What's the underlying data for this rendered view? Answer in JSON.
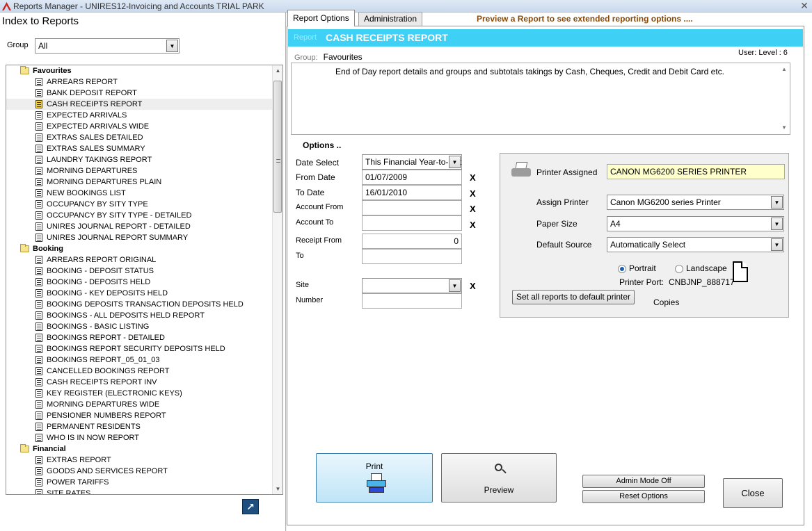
{
  "window": {
    "title": "Reports Manager - UNIRES12-Invoicing and Accounts TRIAL PARK",
    "close_glyph": "✕"
  },
  "left": {
    "heading": "Index to Reports",
    "group_label": "Group",
    "group_value": "All",
    "groups": [
      {
        "name": "Favourites",
        "items": [
          "ARREARS REPORT",
          "BANK DEPOSIT REPORT",
          "CASH RECEIPTS REPORT",
          "EXPECTED ARRIVALS",
          "EXPECTED ARRIVALS WIDE",
          "EXTRAS SALES DETAILED",
          "EXTRAS SALES SUMMARY",
          "LAUNDRY TAKINGS REPORT",
          "MORNING DEPARTURES",
          "MORNING DEPARTURES PLAIN",
          "NEW BOOKINGS LIST",
          "OCCUPANCY BY SITY TYPE",
          "OCCUPANCY BY SITY TYPE - DETAILED",
          "UNIRES JOURNAL REPORT - DETAILED",
          "UNIRES JOURNAL REPORT SUMMARY"
        ]
      },
      {
        "name": "Booking",
        "items": [
          "ARREARS REPORT ORIGINAL",
          "BOOKING - DEPOSIT STATUS",
          "BOOKING - DEPOSITS HELD",
          "BOOKING - KEY DEPOSITS HELD",
          "BOOKING DEPOSITS TRANSACTION DEPOSITS HELD",
          "BOOKINGS - ALL DEPOSITS HELD REPORT",
          "BOOKINGS - BASIC LISTING",
          "BOOKINGS REPORT - DETAILED",
          "BOOKINGS REPORT SECURITY DEPOSITS HELD",
          "BOOKINGS REPORT_05_01_03",
          "CANCELLED BOOKINGS REPORT",
          "CASH RECEIPTS REPORT INV",
          "KEY REGISTER (ELECTRONIC KEYS)",
          "MORNING DEPARTURES WIDE",
          "PENSIONER NUMBERS REPORT",
          "PERMANENT RESIDENTS",
          "WHO IS IN NOW REPORT"
        ]
      },
      {
        "name": "Financial",
        "items": [
          "EXTRAS REPORT",
          "GOODS AND SERVICES REPORT",
          "POWER TARIFFS",
          "SITE RATES"
        ]
      }
    ],
    "selected_item": "CASH RECEIPTS REPORT",
    "help_glyph": "↗"
  },
  "tabs": [
    "Report Options",
    "Administration"
  ],
  "preview_hint": "Preview a Report to see extended reporting options ....",
  "report": {
    "label": "Report",
    "name": "CASH RECEIPTS REPORT",
    "group_label": "Group:",
    "group_value": "Favourites",
    "user_level": "User:  Level : 6",
    "description": "End of Day report details and groups and subtotals takings by Cash, Cheques, Credit and Debit Card etc."
  },
  "options": {
    "title": "Options ..",
    "date_select_label": "Date Select",
    "date_select_value": "This Financial Year-to-Date",
    "from_date_label": "From Date",
    "from_date": "01/07/2009",
    "to_date_label": "To Date",
    "to_date": "16/01/2010",
    "account_from_label": "Account From",
    "account_from": "",
    "account_to_label": "Account To",
    "account_to": "",
    "receipt_from_label": "Receipt From",
    "receipt_from": "0",
    "to_label": "To",
    "receipt_to": "",
    "site_label": "Site",
    "site": "",
    "number_label": "Number",
    "number": "",
    "clear_mark": "X"
  },
  "printer": {
    "assigned_label": "Printer Assigned",
    "assigned_value": "CANON MG6200 SERIES PRINTER",
    "assign_label": "Assign Printer",
    "assign_value": "Canon MG6200 series Printer",
    "paper_label": "Paper Size",
    "paper_value": "A4",
    "source_label": "Default Source",
    "source_value": "Automatically Select",
    "orientation_portrait": "Portrait",
    "orientation_landscape": "Landscape",
    "orientation_selected": "Portrait",
    "port_label": "Printer Port:",
    "port_value": "CNBJNP_888717",
    "set_all_label": "Set all reports to default printer",
    "copies_label": "Copies"
  },
  "buttons": {
    "print": "Print",
    "preview": "Preview",
    "admin_mode": "Admin Mode Off",
    "reset": "Reset Options",
    "close": "Close"
  },
  "combo_arrow": "▼",
  "scroll_up": "▲",
  "scroll_down": "▼"
}
